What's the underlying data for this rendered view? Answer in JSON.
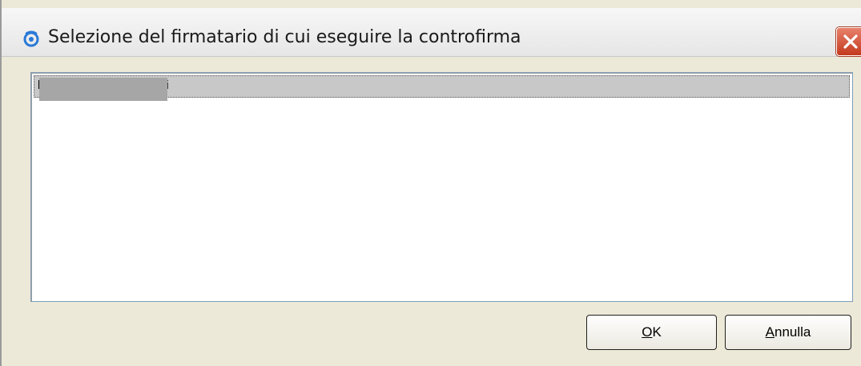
{
  "dialog": {
    "title": "Selezione del firmatario di cui eseguire la controfirma",
    "icon": "eye-logo-icon",
    "close_icon": "close-icon"
  },
  "signers_list": {
    "items": [
      {
        "label_start": "l",
        "label_end": "i",
        "selected": true,
        "redacted": true
      }
    ]
  },
  "buttons": {
    "ok": {
      "mnemonic": "O",
      "rest": "K"
    },
    "cancel": {
      "mnemonic": "A",
      "rest": "nnulla"
    }
  },
  "colors": {
    "dialog_background": "#ece9d8",
    "selected_row": "#c8c8c8",
    "close_button": "#d0553a",
    "app_icon": "#2a7ad8"
  }
}
